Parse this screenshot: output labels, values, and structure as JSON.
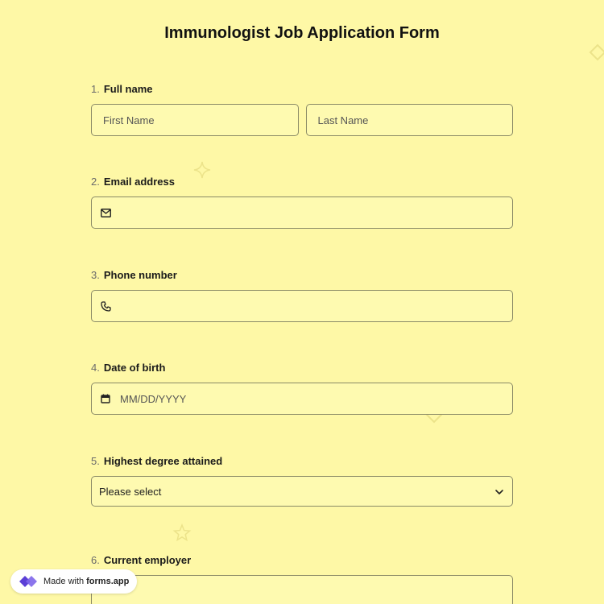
{
  "form": {
    "title": "Immunologist Job Application Form"
  },
  "questions": [
    {
      "number": "1.",
      "label": "Full name",
      "first_placeholder": "First Name",
      "last_placeholder": "Last Name"
    },
    {
      "number": "2.",
      "label": "Email address",
      "icon": "mail-icon",
      "value": ""
    },
    {
      "number": "3.",
      "label": "Phone number",
      "icon": "phone-icon",
      "value": ""
    },
    {
      "number": "4.",
      "label": "Date of birth",
      "icon": "calendar-icon",
      "placeholder": "MM/DD/YYYY"
    },
    {
      "number": "5.",
      "label": "Highest degree attained",
      "selected": "Please select"
    },
    {
      "number": "6.",
      "label": "Current employer",
      "value": ""
    }
  ],
  "badge": {
    "made_with": "Made with",
    "brand": "forms.app"
  },
  "colors": {
    "background": "#fef8a6",
    "field_background": "#fefab0",
    "field_border": "#8a8a66",
    "logo": "#5b3fd6"
  }
}
